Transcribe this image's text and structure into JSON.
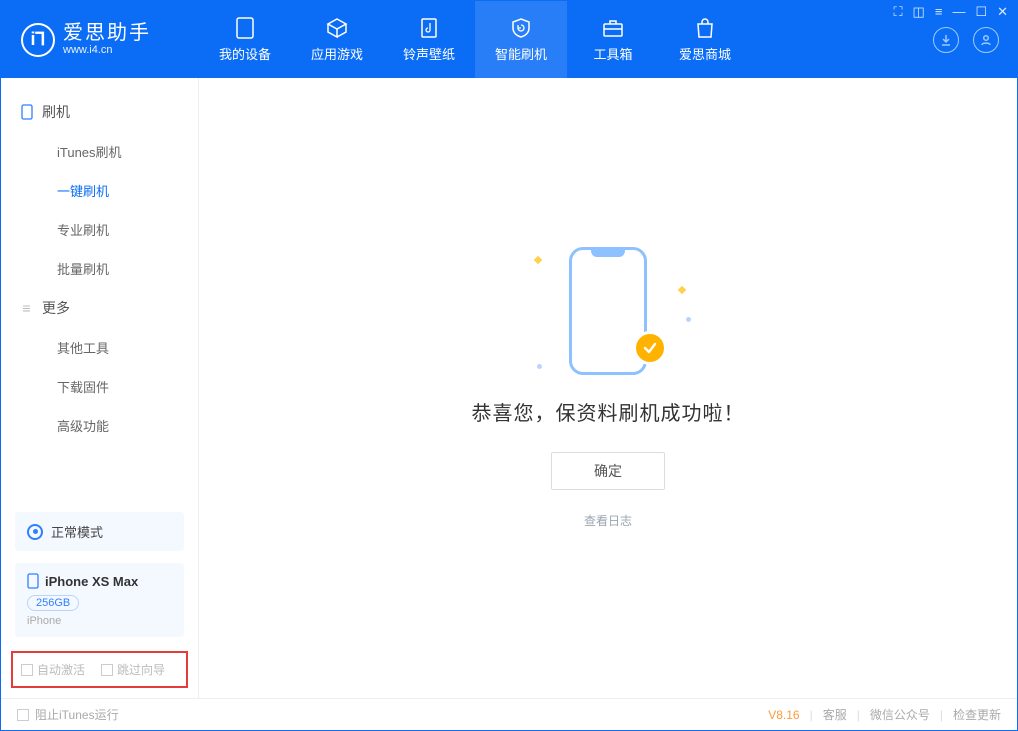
{
  "app": {
    "title": "爱思助手",
    "subtitle": "www.i4.cn"
  },
  "header_tabs": [
    {
      "label": "我的设备"
    },
    {
      "label": "应用游戏"
    },
    {
      "label": "铃声壁纸"
    },
    {
      "label": "智能刷机"
    },
    {
      "label": "工具箱"
    },
    {
      "label": "爱思商城"
    }
  ],
  "sidebar": {
    "group1_title": "刷机",
    "group1_items": [
      "iTunes刷机",
      "一键刷机",
      "专业刷机",
      "批量刷机"
    ],
    "group2_title": "更多",
    "group2_items": [
      "其他工具",
      "下载固件",
      "高级功能"
    ]
  },
  "mode": {
    "label": "正常模式"
  },
  "device": {
    "name": "iPhone XS Max",
    "capacity": "256GB",
    "type": "iPhone"
  },
  "options": {
    "auto_activate": "自动激活",
    "skip_guide": "跳过向导"
  },
  "main": {
    "success_text": "恭喜您，保资料刷机成功啦！",
    "confirm_label": "确定",
    "log_link": "查看日志"
  },
  "footer": {
    "block_itunes": "阻止iTunes运行",
    "version": "V8.16",
    "links": [
      "客服",
      "微信公众号",
      "检查更新"
    ]
  }
}
